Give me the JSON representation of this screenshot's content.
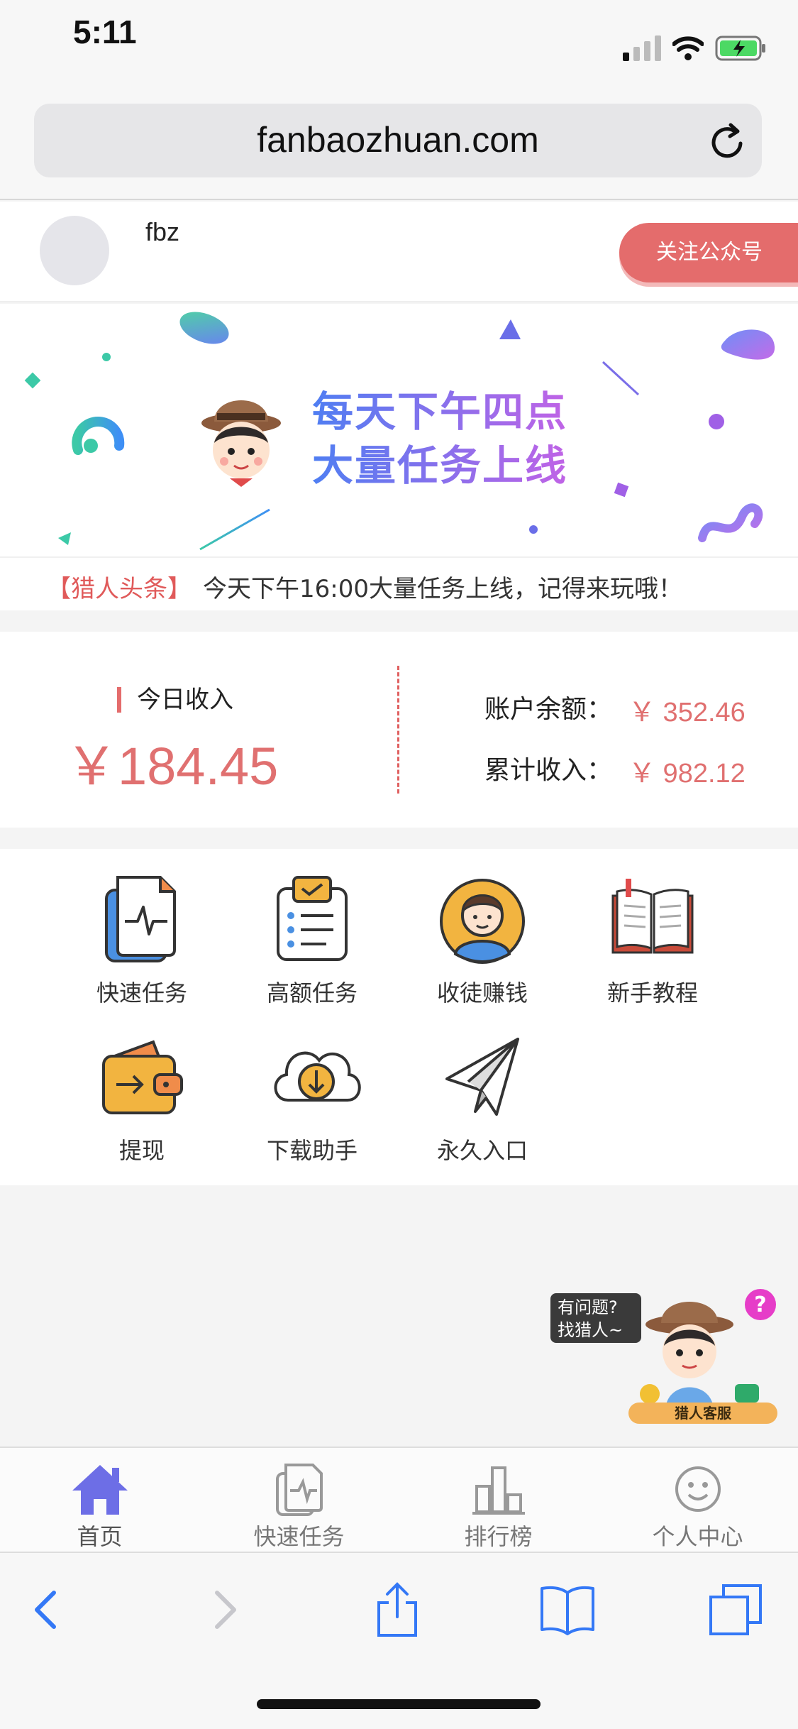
{
  "status_bar": {
    "time": "5:11"
  },
  "browser": {
    "url": "fanbaozhuan.com"
  },
  "header": {
    "username": "fbz",
    "follow_label": "关注公众号"
  },
  "banner": {
    "line1": "每天下午四点",
    "line2": "大量任务上线"
  },
  "ticker": {
    "tag": "【猎人头条】",
    "message": "今天下午16:00大量任务上线，记得来玩哦！"
  },
  "income": {
    "today_label": "今日收入",
    "today_value": "￥184.45",
    "balance_label": "账户余额：",
    "balance_value": "￥ 352.46",
    "total_label": "累计收入：",
    "total_value": "￥ 982.12"
  },
  "menu": {
    "items": [
      {
        "label": "快速任务",
        "icon": "quick-task-icon"
      },
      {
        "label": "高额任务",
        "icon": "clipboard-icon"
      },
      {
        "label": "收徒赚钱",
        "icon": "person-icon"
      },
      {
        "label": "新手教程",
        "icon": "book-icon"
      },
      {
        "label": "提现",
        "icon": "wallet-icon"
      },
      {
        "label": "下载助手",
        "icon": "cloud-download-icon"
      },
      {
        "label": "永久入口",
        "icon": "paper-plane-icon"
      }
    ]
  },
  "service": {
    "bubble_line1": "有问题?",
    "bubble_line2": "找猎人~",
    "badge": "猎人客服"
  },
  "tabbar": {
    "items": [
      {
        "label": "首页",
        "icon": "home-icon"
      },
      {
        "label": "快速任务",
        "icon": "quick-task-icon"
      },
      {
        "label": "排行榜",
        "icon": "bar-chart-icon"
      },
      {
        "label": "个人中心",
        "icon": "smiley-icon"
      }
    ]
  },
  "colors": {
    "accent": "#e46c6c",
    "tab_active": "#6d6ee6",
    "ios_blue": "#3478f6"
  }
}
